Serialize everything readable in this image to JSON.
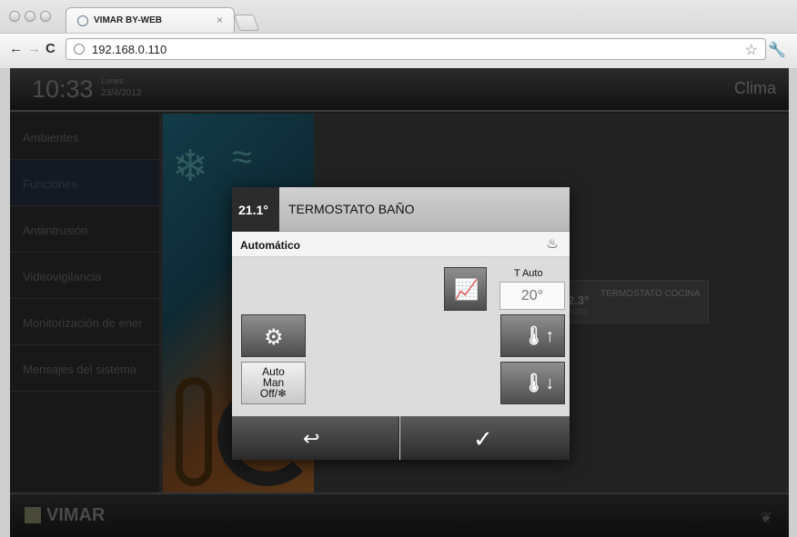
{
  "browser": {
    "tab_title": "VIMAR BY-WEB",
    "tab_close": "×",
    "url": "192.168.0.110",
    "back_glyph": "←",
    "forward_glyph": "→",
    "reload_glyph": "C",
    "star_glyph": "☆",
    "wrench_glyph": "🔧"
  },
  "topbar": {
    "time": "10:33",
    "day": "Lunes",
    "date": "23/4/2012",
    "section": "Clima"
  },
  "menu": {
    "items": [
      {
        "label": "Ambientes"
      },
      {
        "label": "Funciones"
      },
      {
        "label": "Antiintrusión"
      },
      {
        "label": "Videovigilancia"
      },
      {
        "label": "Monitorización de ener"
      },
      {
        "label": "Mensajes del sistema"
      }
    ]
  },
  "background_tiles": {
    "cocina_temp": "2.3°",
    "cocina_mode": "AUTO",
    "cocina_name": "TERMOSTATO COCINA"
  },
  "modal": {
    "temp": "21.1°",
    "title": "TERMOSTATO BAÑO",
    "mode": "Automático",
    "flame_glyph": "♨",
    "tauto_label": "T Auto",
    "tauto_value": "20°",
    "chart_glyph": "📈",
    "gear_glyph": "⚙",
    "mode_line1": "Auto",
    "mode_line2": "Man",
    "mode_line3": "Off/❄",
    "up_glyph": "🌡↑",
    "down_glyph": "🌡↓",
    "back_glyph": "↩",
    "ok_glyph": "✓"
  },
  "footer": {
    "logo": "VIMAR",
    "leaf_glyph": "❦"
  }
}
